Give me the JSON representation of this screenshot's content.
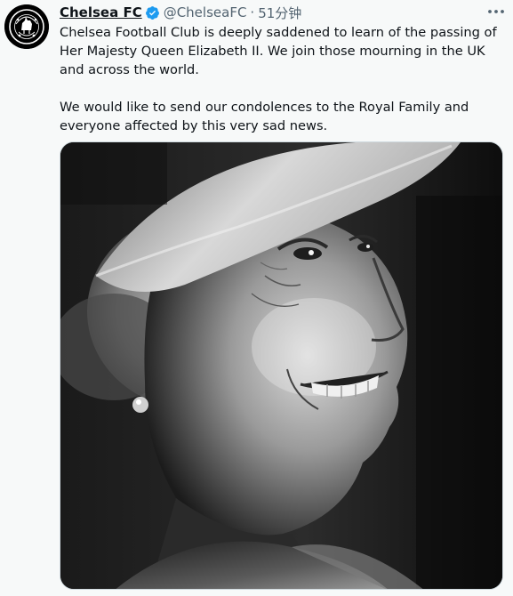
{
  "account": {
    "name": "Chelsea FC",
    "handle": "@ChelseaFC",
    "separator": "·",
    "time": "51分钟",
    "verified": true,
    "avatar_icon": "chelsea-crest-icon"
  },
  "tweet": {
    "paragraph1": "Chelsea Football Club is deeply saddened to learn of the passing of Her Majesty Queen Elizabeth II. We join those mourning in the UK and across the world.",
    "paragraph2": "We would like to send our condolences to the Royal Family and everyone affected by this very sad news."
  },
  "media": {
    "type": "photo",
    "style": "black-and-white portrait"
  },
  "icons": {
    "more": "more-options-icon",
    "verified": "verified-badge-icon"
  },
  "colors": {
    "background": "#f7f9f9",
    "text": "#0f1419",
    "secondary_text": "#536471",
    "verified": "#1d9bf0"
  }
}
